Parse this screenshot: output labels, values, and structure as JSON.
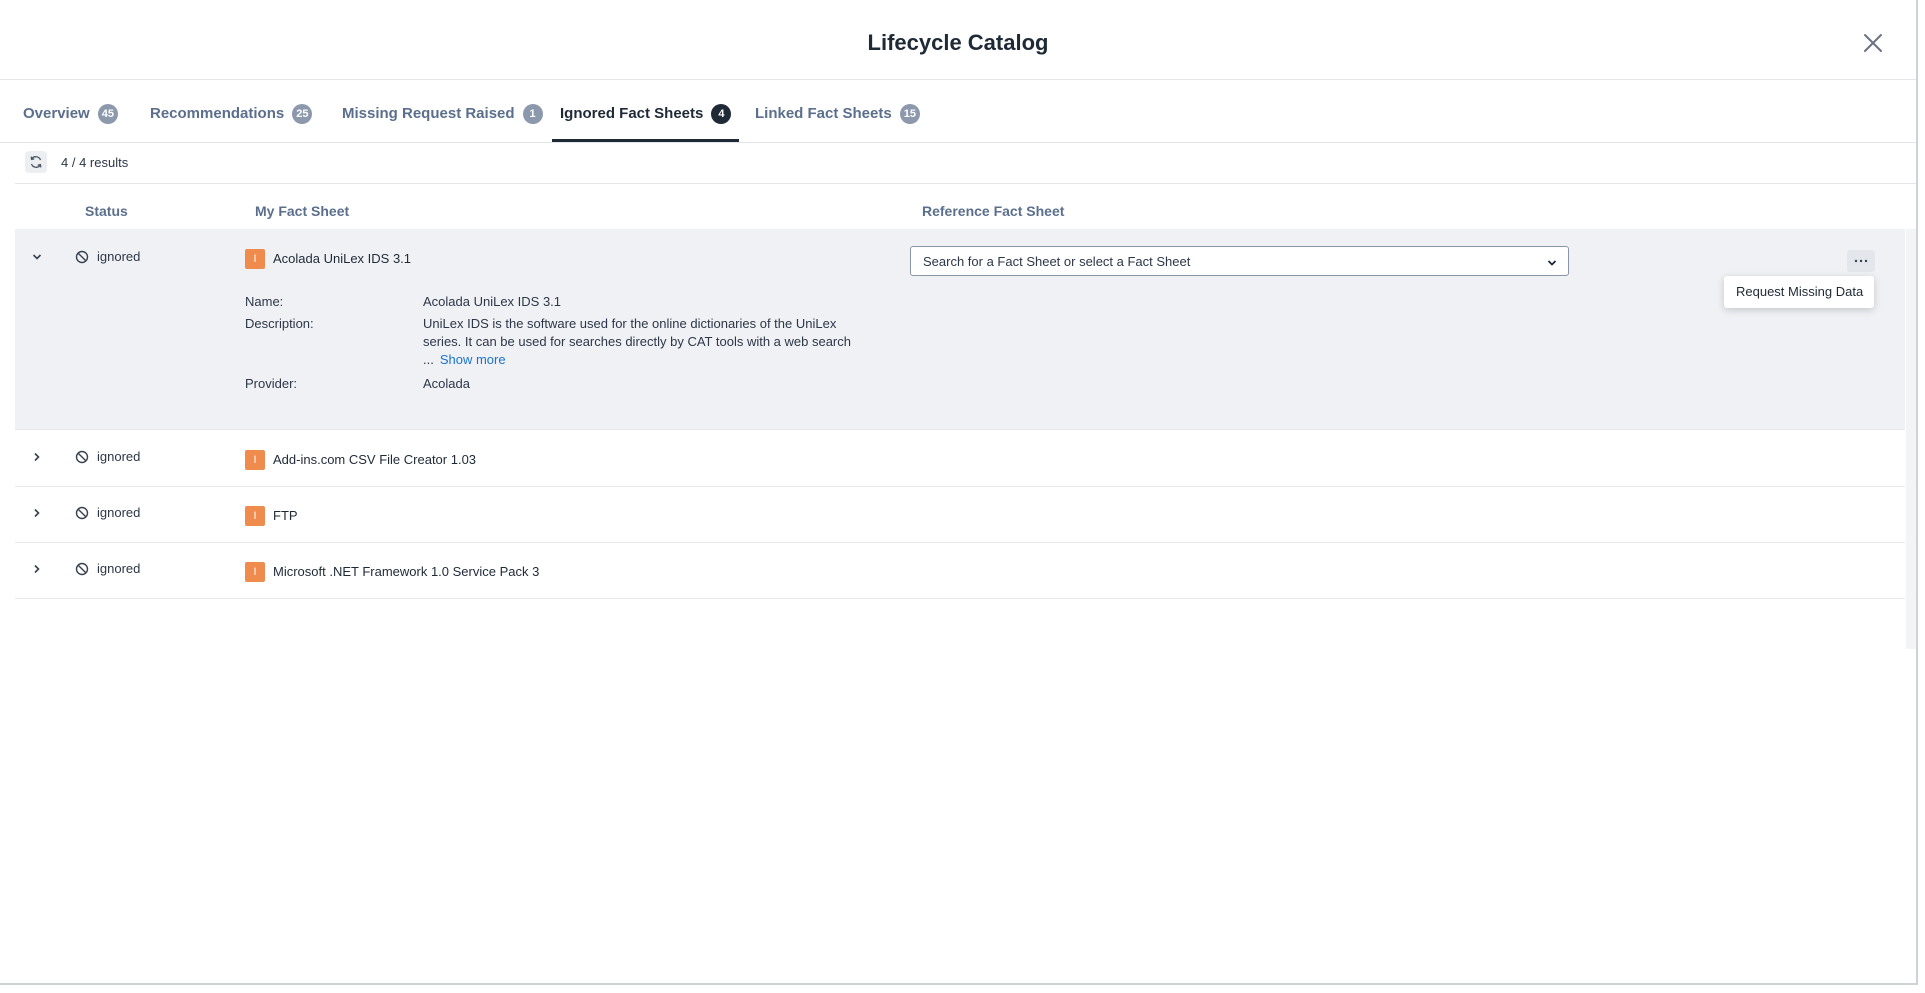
{
  "dialog": {
    "title": "Lifecycle Catalog",
    "close_icon": "close-icon"
  },
  "tabs": [
    {
      "label": "Overview",
      "count": "45",
      "active": false
    },
    {
      "label": "Recommendations",
      "count": "25",
      "active": false
    },
    {
      "label": "Missing Request Raised",
      "count": "1",
      "active": false
    },
    {
      "label": "Ignored Fact Sheets",
      "count": "4",
      "active": true
    },
    {
      "label": "Linked Fact Sheets",
      "count": "15",
      "active": false
    }
  ],
  "toolbar": {
    "results": "4 / 4 results",
    "refresh_icon": "refresh-icon"
  },
  "columns": {
    "status": "Status",
    "my_fact_sheet": "My Fact Sheet",
    "reference_fact_sheet": "Reference Fact Sheet"
  },
  "rows": [
    {
      "status": "ignored",
      "type_letter": "I",
      "name": "Acolada UniLex IDS 3.1",
      "details": {
        "name_label": "Name:",
        "name_value": "Acolada UniLex IDS 3.1",
        "description_label": "Description:",
        "description_value": "UniLex IDS is the software used for the online dictionaries of the UniLex series. It can be used for searches directly by CAT tools with a web search ...",
        "show_more": "Show more",
        "provider_label": "Provider:",
        "provider_value": "Acolada"
      },
      "reference_placeholder": "Search for a Fact Sheet or select a Fact Sheet",
      "menu_item": "Request Missing Data"
    },
    {
      "status": "ignored",
      "type_letter": "I",
      "name": "Add-ins.com CSV File Creator 1.03"
    },
    {
      "status": "ignored",
      "type_letter": "I",
      "name": "FTP"
    },
    {
      "status": "ignored",
      "type_letter": "I",
      "name": "Microsoft .NET Framework 1.0 Service Pack 3"
    }
  ],
  "colors": {
    "accent_dark": "#1f2a37",
    "muted_tab": "#5b6f8d",
    "fact_sheet_badge": "#f08b4e",
    "link": "#1a73d1"
  }
}
